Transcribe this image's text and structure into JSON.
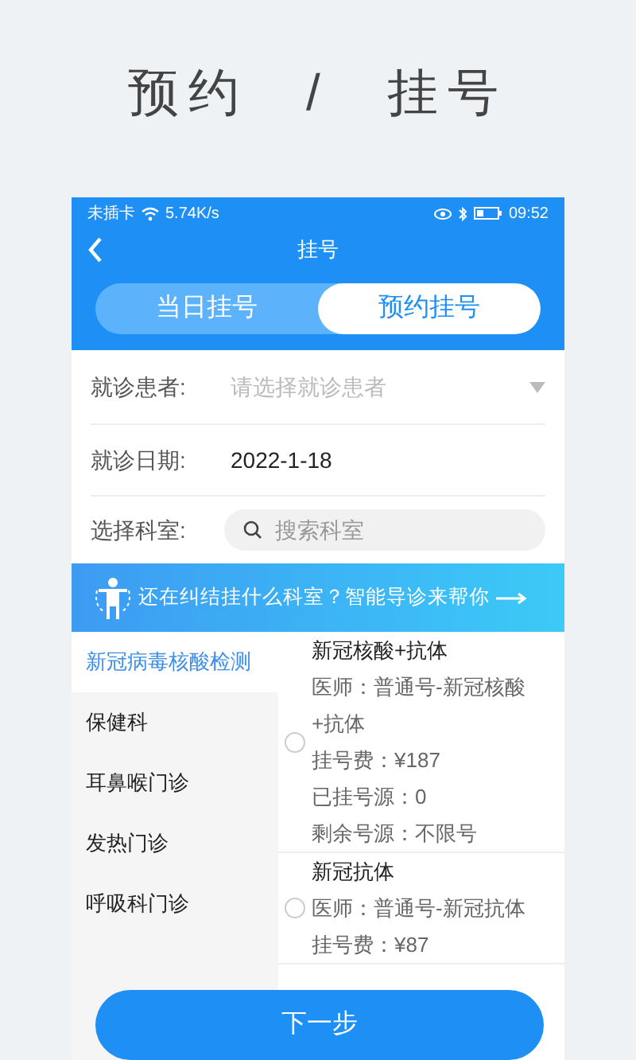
{
  "headline": [
    "预约",
    "/",
    "挂号"
  ],
  "status_bar": {
    "carrier": "未插卡",
    "speed": "5.74K/s",
    "time": "09:52"
  },
  "nav": {
    "title": "挂号"
  },
  "tabs": [
    {
      "label": "当日挂号",
      "selected": false
    },
    {
      "label": "预约挂号",
      "selected": true
    }
  ],
  "form": {
    "patient": {
      "label": "就诊患者:",
      "placeholder": "请选择就诊患者"
    },
    "date": {
      "label": "就诊日期:",
      "value": "2022-1-18"
    },
    "department": {
      "label": "选择科室:",
      "placeholder": "搜索科室"
    }
  },
  "banner": {
    "text": "还在纠结挂什么科室？智能导诊来帮你"
  },
  "departments": [
    {
      "name": "新冠病毒核酸检测",
      "selected": true
    },
    {
      "name": "保健科",
      "selected": false
    },
    {
      "name": "耳鼻喉门诊",
      "selected": false
    },
    {
      "name": "发热门诊",
      "selected": false
    },
    {
      "name": "呼吸科门诊",
      "selected": false
    }
  ],
  "slots": [
    {
      "name": "新冠核酸+抗体",
      "selected": false,
      "lines": [
        "医师：普通号-新冠核酸+抗体",
        "挂号费：¥187",
        "已挂号源：0",
        "剩余号源：不限号"
      ]
    },
    {
      "name": "新冠抗体",
      "selected": false,
      "lines": [
        "医师：普通号-新冠抗体",
        "挂号费：¥87"
      ]
    }
  ],
  "next_button": "下一步"
}
